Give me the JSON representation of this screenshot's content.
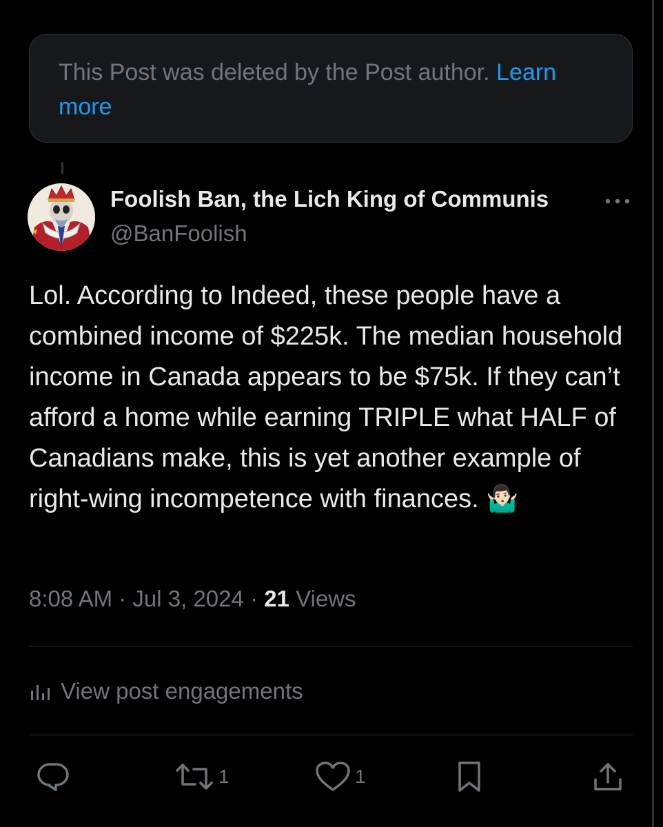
{
  "deleted_notice": {
    "text": "This Post was deleted by the Post author. ",
    "link": "Learn more"
  },
  "author": {
    "display_name": "Foolish Ban, the Lich King of Communis",
    "handle": "@BanFoolish"
  },
  "post": {
    "text": "Lol. According to Indeed, these people have a combined income of $225k. The median household income in Canada appears to be $75k. If they can’t afford a home while earning TRIPLE what HALF of Canadians make, this is yet another example of right-wing incompetence with finances. 🤷🏻‍♂️"
  },
  "meta": {
    "time": "8:08 AM",
    "separator": " · ",
    "date": "Jul 3, 2024",
    "views_count": "21",
    "views_label": " Views"
  },
  "engagements": {
    "label": "View post engagements",
    "icon": "bar-chart-icon"
  },
  "actions": {
    "reply_icon": "reply-icon",
    "repost_icon": "repost-icon",
    "repost_count": "1",
    "like_icon": "heart-icon",
    "like_count": "1",
    "bookmark_icon": "bookmark-icon",
    "share_icon": "share-icon"
  },
  "colors": {
    "background": "#000000",
    "text": "#e7e9ea",
    "muted": "#71767b",
    "link": "#1d9bf0",
    "border": "#2f3336"
  }
}
